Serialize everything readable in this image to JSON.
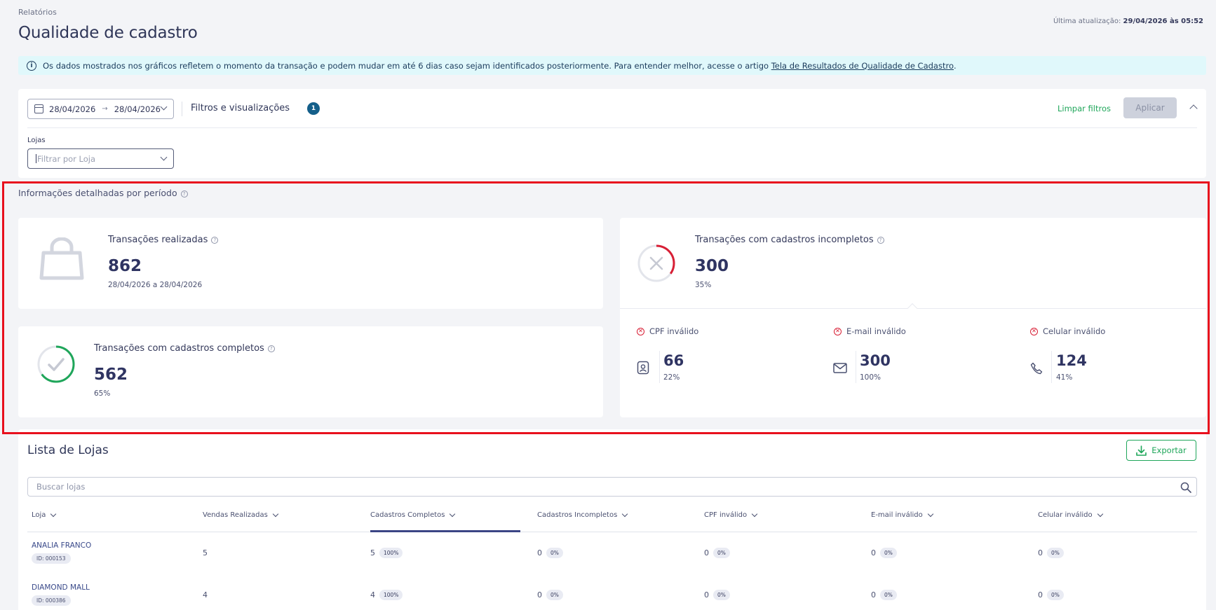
{
  "breadcrumb": "Relatórios",
  "title": "Qualidade de cadastro",
  "last_update": {
    "label": "Última atualização:",
    "value": "29/04/2026 às 05:52"
  },
  "banner": {
    "text": "Os dados mostrados nos gráficos refletem o momento da transação e podem mudar em até 6 dias caso sejam identificados posteriormente. Para entender melhor, acesse o artigo",
    "link": "Tela de Resultados de Qualidade de Cadastro",
    "suffix": "."
  },
  "filters": {
    "date_from": "28/04/2026",
    "date_arrow": "→",
    "date_to": "28/04/2026",
    "title": "Filtros e visualizações",
    "badge": "1",
    "clear": "Limpar filtros",
    "apply": "Aplicar",
    "stores_label": "Lojas",
    "stores_placeholder": "Filtrar por Loja"
  },
  "section_title": "Informações detalhadas por período",
  "cards": {
    "transactions": {
      "title": "Transações realizadas",
      "value": "862",
      "sub": "28/04/2026 a 28/04/2026"
    },
    "complete": {
      "title": "Transações com cadastros completos",
      "value": "562",
      "sub": "65%"
    },
    "incomplete": {
      "title": "Transações com cadastros incompletos",
      "value": "300",
      "sub": "35%"
    }
  },
  "invalid": [
    {
      "label": "CPF inválido",
      "value": "66",
      "pct": "22%",
      "icon": "id-badge-icon"
    },
    {
      "label": "E-mail inválido",
      "value": "300",
      "pct": "100%",
      "icon": "mail-icon"
    },
    {
      "label": "Celular inválido",
      "value": "124",
      "pct": "41%",
      "icon": "phone-icon"
    }
  ],
  "progress": {
    "complete_fraction": 0.65,
    "incomplete_fraction": 0.35
  },
  "colors": {
    "accent_green": "#1fa65a",
    "alert_red": "#d81f35",
    "badge_blue": "#145f8a",
    "highlight_red": "#e8101d"
  },
  "list": {
    "title": "Lista de Lojas",
    "export": "Exportar",
    "search_placeholder": "Buscar lojas",
    "columns": [
      "Loja",
      "Vendas Realizadas",
      "Cadastros Completos",
      "Cadastros Incompletos",
      "CPF inválido",
      "E-mail inválido",
      "Celular inválido"
    ],
    "rows": [
      {
        "name": "ANALIA FRANCO",
        "id": "ID: 000153",
        "sales": "5",
        "complete": "5",
        "complete_pct": "100%",
        "incomplete": "0",
        "incomplete_pct": "0%",
        "cpf": "0",
        "cpf_pct": "0%",
        "email": "0",
        "email_pct": "0%",
        "phone": "0",
        "phone_pct": "0%"
      },
      {
        "name": "DIAMOND MALL",
        "id": "ID: 000386",
        "sales": "4",
        "complete": "4",
        "complete_pct": "100%",
        "incomplete": "0",
        "incomplete_pct": "0%",
        "cpf": "0",
        "cpf_pct": "0%",
        "email": "0",
        "email_pct": "0%",
        "phone": "0",
        "phone_pct": "0%"
      }
    ]
  }
}
